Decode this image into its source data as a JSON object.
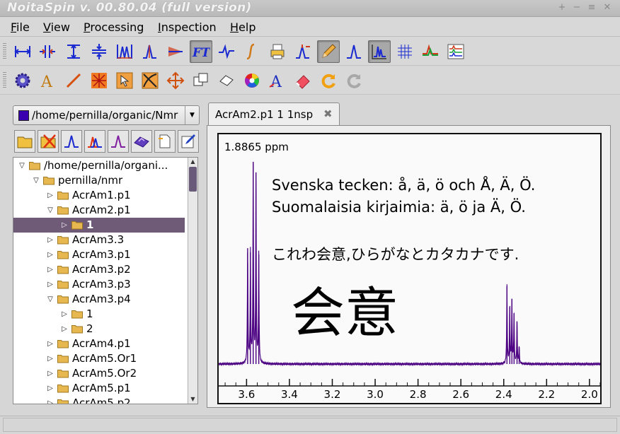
{
  "window": {
    "title": "NoitaSpin v. 00.80.04 (full version)",
    "controls": [
      "+",
      "−",
      "≡",
      "✕"
    ]
  },
  "menu": [
    {
      "label": "File",
      "accel": "F",
      "rest": "ile"
    },
    {
      "label": "View",
      "accel": "V",
      "rest": "iew"
    },
    {
      "label": "Processing",
      "accel": "P",
      "rest": "rocessing"
    },
    {
      "label": "Inspection",
      "accel": "I",
      "rest": "nspection"
    },
    {
      "label": "Help",
      "accel": "H",
      "rest": "elp"
    }
  ],
  "toolbar1": [
    {
      "icon": "set-range-icon"
    },
    {
      "icon": "split-icon"
    },
    {
      "icon": "vertical-range-icon"
    },
    {
      "icon": "compress-icon"
    },
    {
      "icon": "zoom-peaks-icon"
    },
    {
      "icon": "peak-pick-icon"
    },
    {
      "icon": "phase-icon"
    },
    {
      "icon": "fourier-transform-icon",
      "text": "FT",
      "active": true
    },
    {
      "icon": "baseline-icon"
    },
    {
      "icon": "integral-icon"
    },
    {
      "icon": "print-icon"
    },
    {
      "icon": "peak-height-icon"
    },
    {
      "icon": "pencil-icon",
      "active": true
    },
    {
      "icon": "single-peak-icon"
    },
    {
      "icon": "spectrum-view-icon",
      "active": true
    },
    {
      "icon": "grid-icon"
    },
    {
      "icon": "compare-spectra-icon"
    },
    {
      "icon": "multi-spectra-icon"
    }
  ],
  "toolbar2": [
    {
      "icon": "settings-gear-icon"
    },
    {
      "icon": "text-icon",
      "text": "A"
    },
    {
      "icon": "line-tool-icon"
    },
    {
      "icon": "explode-icon"
    },
    {
      "icon": "pointer-icon"
    },
    {
      "icon": "crop-icon"
    },
    {
      "icon": "move-icon"
    },
    {
      "icon": "copy-icon"
    },
    {
      "icon": "eraser-shape-icon"
    },
    {
      "icon": "color-wheel-icon"
    },
    {
      "icon": "font-icon",
      "text": "A"
    },
    {
      "icon": "eraser-icon"
    },
    {
      "icon": "redo-icon"
    },
    {
      "icon": "refresh-icon"
    }
  ],
  "left": {
    "path_combo": "/home/pernilla/organic/Nmr",
    "tree_tools": [
      {
        "icon": "open-folder-icon"
      },
      {
        "icon": "close-folder-icon"
      },
      {
        "icon": "single-spectrum-icon"
      },
      {
        "icon": "multiple-spectra-icon"
      },
      {
        "icon": "peak-spectrum-icon"
      },
      {
        "icon": "3d-surface-icon"
      },
      {
        "icon": "document-icon"
      },
      {
        "icon": "edit-note-icon"
      }
    ],
    "tree": [
      {
        "label": "/home/pernilla/organi...",
        "level": 0,
        "expanded": true
      },
      {
        "label": "pernilla/nmr",
        "level": 1,
        "expanded": true
      },
      {
        "label": "AcrAm1.p1",
        "level": 2,
        "expanded": false
      },
      {
        "label": "AcrAm2.p1",
        "level": 2,
        "expanded": true
      },
      {
        "label": "1",
        "level": 3,
        "expanded": false,
        "selected": true
      },
      {
        "label": "AcrAm3.3",
        "level": 2,
        "expanded": false
      },
      {
        "label": "AcrAm3.p1",
        "level": 2,
        "expanded": false
      },
      {
        "label": "AcrAm3.p2",
        "level": 2,
        "expanded": false
      },
      {
        "label": "AcrAm3.p3",
        "level": 2,
        "expanded": false
      },
      {
        "label": "AcrAm3.p4",
        "level": 2,
        "expanded": true
      },
      {
        "label": "1",
        "level": 3,
        "expanded": false
      },
      {
        "label": "2",
        "level": 3,
        "expanded": false
      },
      {
        "label": "AcrAm4.p1",
        "level": 2,
        "expanded": false
      },
      {
        "label": "AcrAm5.Or1",
        "level": 2,
        "expanded": false
      },
      {
        "label": "AcrAm5.Or2",
        "level": 2,
        "expanded": false
      },
      {
        "label": "AcrAm5.p1",
        "level": 2,
        "expanded": false
      },
      {
        "label": "AcrAm5.p2",
        "level": 2,
        "expanded": false
      }
    ]
  },
  "tab": {
    "label": "AcrAm2.p1 1 1nsp",
    "close": "✖"
  },
  "spectrum": {
    "cursor_readout": "1.8865 ppm",
    "annotations": {
      "line1": "Svenska tecken: å, ä, ö och Å, Ä, Ö.",
      "line2": "Suomalaisia kirjaimia: ä, ö  ja  Ä, Ö.",
      "line3": "これわ会意,ひらがなとカタカナです.",
      "big": "会意"
    },
    "x_ticks": [
      "3.6",
      "3.4",
      "3.2",
      "3.0",
      "2.8",
      "2.6",
      "2.4",
      "2.2",
      "2.0"
    ],
    "line_color": "#4b0082"
  },
  "chart_data": {
    "type": "line",
    "xlabel": "",
    "ylabel": "",
    "x_direction": "descending",
    "xlim": [
      3.73,
      1.95
    ],
    "baseline": 0.0,
    "peaks": [
      {
        "x": 3.595,
        "height": 0.55
      },
      {
        "x": 3.582,
        "height": 0.53
      },
      {
        "x": 3.569,
        "height": 0.96
      },
      {
        "x": 3.556,
        "height": 0.91
      },
      {
        "x": 3.543,
        "height": 0.52
      },
      {
        "x": 2.385,
        "height": 0.37
      },
      {
        "x": 2.372,
        "height": 0.27
      },
      {
        "x": 2.362,
        "height": 0.31
      },
      {
        "x": 2.352,
        "height": 0.24
      },
      {
        "x": 2.338,
        "height": 0.2
      },
      {
        "x": 2.328,
        "height": 0.08
      }
    ]
  }
}
